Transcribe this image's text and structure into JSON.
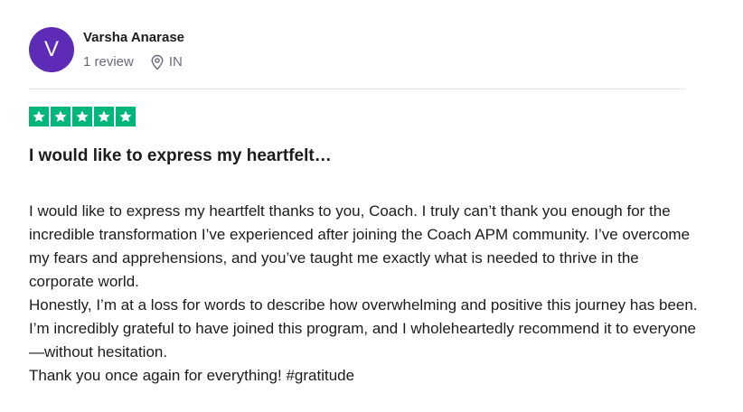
{
  "reviewer": {
    "avatar_initial": "V",
    "avatar_color": "#5d2bb5",
    "name": "Varsha Anarase",
    "review_count": "1 review",
    "location_icon": "location-pin-icon",
    "country": "IN"
  },
  "rating": {
    "stars": 5,
    "max": 5,
    "color": "#00b67a"
  },
  "review": {
    "title": "I would like to express my heartfelt…",
    "paragraphs": [
      "I would like to express my heartfelt thanks to you, Coach. I truly can’t thank you enough for the incredible transformation I’ve experienced after joining the Coach APM community. I’ve overcome my fears and apprehensions, and you’ve taught me exactly what is needed to thrive in the corporate world.",
      "Honestly, I’m at a loss for words to describe how overwhelming and positive this journey has been. I’m incredibly grateful to have joined this program, and I wholeheartedly recommend it to everyone—without hesitation.",
      "Thank you once again for everything! #gratitude"
    ]
  }
}
